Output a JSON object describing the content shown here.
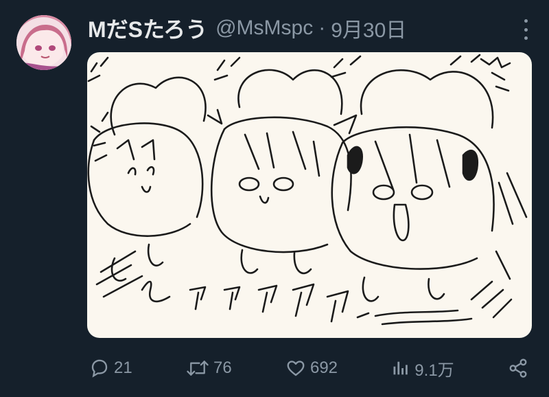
{
  "post": {
    "author": {
      "display_name": "MだSたろう",
      "handle": "@MsMspc",
      "avatar_icon": "avatar-image"
    },
    "separator": "·",
    "date": "9月30日",
    "more_icon": "more-dots-icon"
  },
  "actions": {
    "replies": "21",
    "reposts": "76",
    "likes": "692",
    "views": "9.1万",
    "share_icon": "share-icon"
  },
  "colors": {
    "background": "#15202b",
    "text": "#e7e9ea",
    "muted": "#8b98a5",
    "image_bg": "#fbf7ef"
  }
}
